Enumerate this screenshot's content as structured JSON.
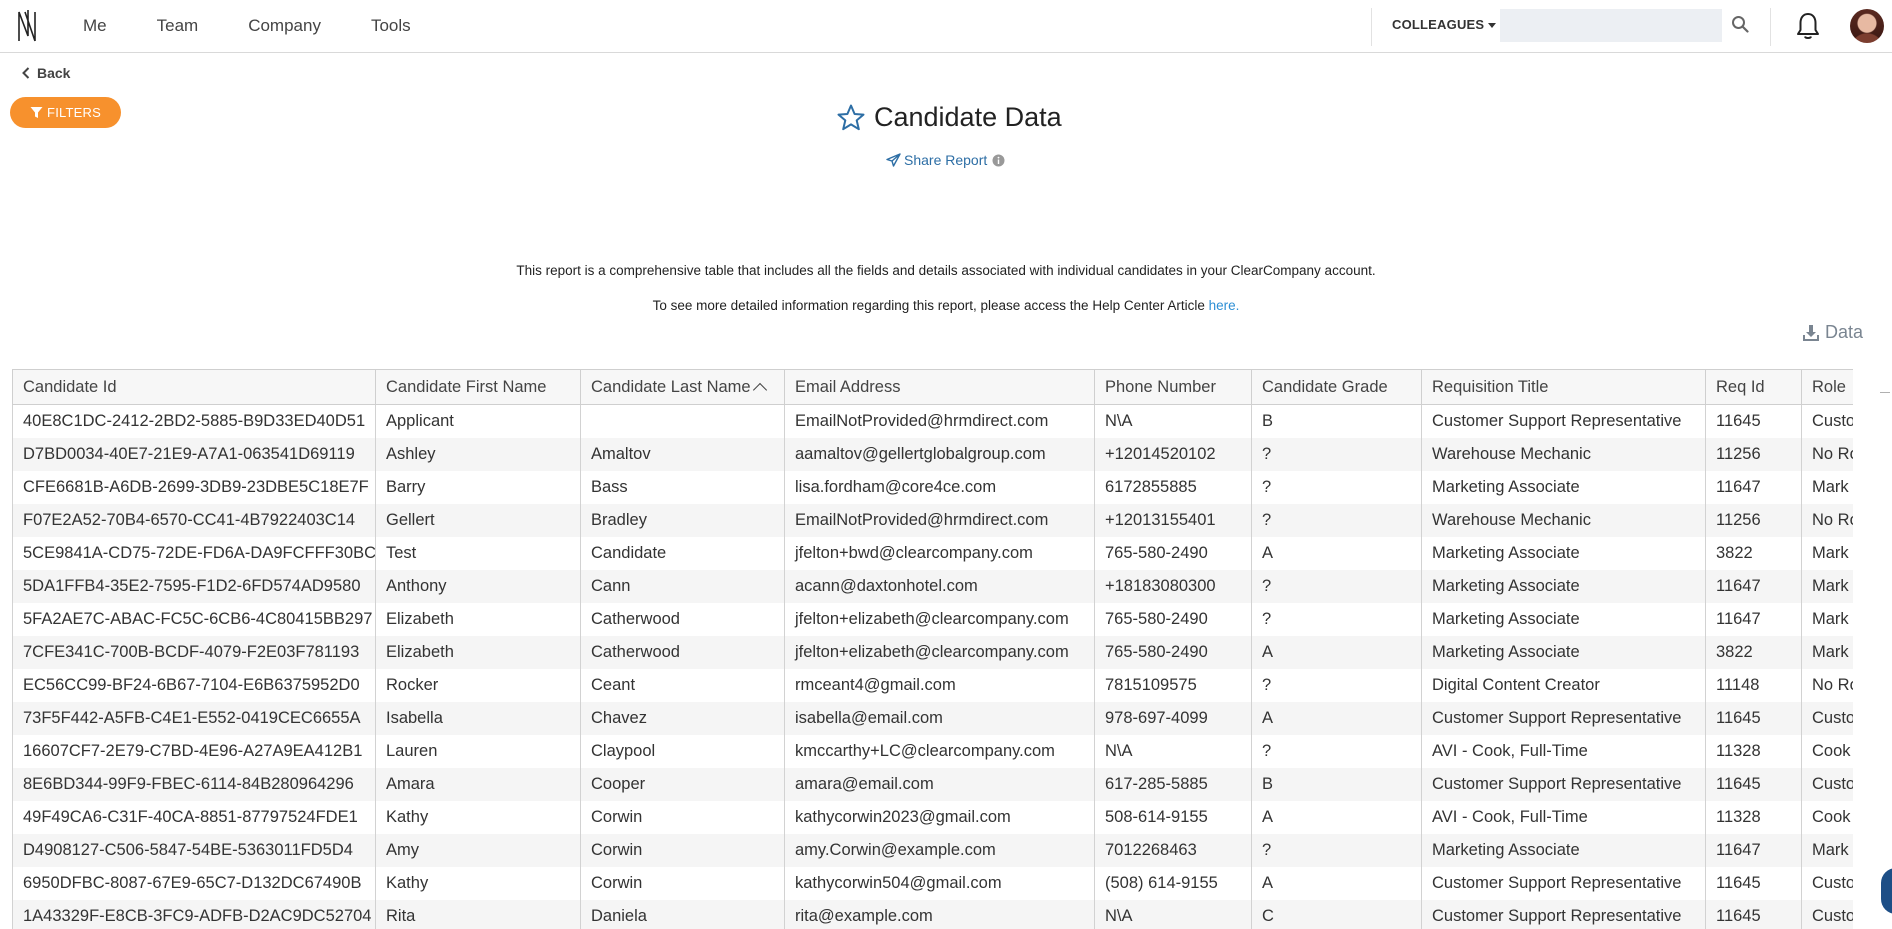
{
  "nav": {
    "links": [
      "Me",
      "Team",
      "Company",
      "Tools"
    ],
    "colleagues_label": "COLLEAGUES",
    "search_placeholder": ""
  },
  "back_label": "Back",
  "filters_label": "FILTERS",
  "report": {
    "title": "Candidate Data",
    "share_label": "Share Report",
    "description": "This report is a comprehensive table that includes all the fields and details associated with individual candidates in your ClearCompany account.",
    "help_text": "To see more detailed information regarding this report, please access the Help Center Article ",
    "help_link": "here."
  },
  "data_button_label": "Data",
  "table": {
    "columns": [
      "Candidate Id",
      "Candidate First Name",
      "Candidate Last Name",
      "Email Address",
      "Phone Number",
      "Candidate Grade",
      "Requisition Title",
      "Req Id",
      "Role"
    ],
    "sorted_column": "Candidate Last Name",
    "sort_direction": "ascending",
    "rows": [
      [
        "40E8C1DC-2412-2BD2-5885-B9D33ED40D51",
        "Applicant",
        "",
        "EmailNotProvided@hrmdirect.com",
        "N\\A",
        "B",
        "Customer Support Representative",
        "11645",
        "Custo"
      ],
      [
        "D7BD0034-40E7-21E9-A7A1-063541D69119",
        "Ashley",
        "Amaltov",
        "aamaltov@gellertglobalgroup.com",
        "+12014520102",
        "?",
        "Warehouse Mechanic",
        "11256",
        "No Ro"
      ],
      [
        "CFE6681B-A6DB-2699-3DB9-23DBE5C18E7F",
        "Barry",
        "Bass",
        "lisa.fordham@core4ce.com",
        "6172855885",
        "?",
        "Marketing Associate",
        "11647",
        "Mark"
      ],
      [
        "F07E2A52-70B4-6570-CC41-4B7922403C14",
        "Gellert",
        "Bradley",
        "EmailNotProvided@hrmdirect.com",
        "+12013155401",
        "?",
        "Warehouse Mechanic",
        "11256",
        "No Ro"
      ],
      [
        "5CE9841A-CD75-72DE-FD6A-DA9FCFFF30BC",
        "Test",
        "Candidate",
        "jfelton+bwd@clearcompany.com",
        "765-580-2490",
        "A",
        "Marketing Associate",
        "3822",
        "Mark"
      ],
      [
        "5DA1FFB4-35E2-7595-F1D2-6FD574AD9580",
        "Anthony",
        "Cann",
        "acann@daxtonhotel.com",
        "+18183080300",
        "?",
        "Marketing Associate",
        "11647",
        "Mark"
      ],
      [
        "5FA2AE7C-ABAC-FC5C-6CB6-4C80415BB297",
        "Elizabeth",
        "Catherwood",
        "jfelton+elizabeth@clearcompany.com",
        "765-580-2490",
        "?",
        "Marketing Associate",
        "11647",
        "Mark"
      ],
      [
        "7CFE341C-700B-BCDF-4079-F2E03F781193",
        "Elizabeth",
        "Catherwood",
        "jfelton+elizabeth@clearcompany.com",
        "765-580-2490",
        "A",
        "Marketing Associate",
        "3822",
        "Mark"
      ],
      [
        "EC56CC99-BF24-6B67-7104-E6B6375952D0",
        "Rocker",
        "Ceant",
        "rmceant4@gmail.com",
        "7815109575",
        "?",
        "Digital Content Creator",
        "11148",
        "No Ro"
      ],
      [
        "73F5F442-A5FB-C4E1-E552-0419CEC6655A",
        "Isabella",
        "Chavez",
        "isabella@email.com",
        "978-697-4099",
        "A",
        "Customer Support Representative",
        "11645",
        "Custo"
      ],
      [
        "16607CF7-2E79-C7BD-4E96-A27A9EA412B1",
        "Lauren",
        "Claypool",
        "kmccarthy+LC@clearcompany.com",
        "N\\A",
        "?",
        "AVI - Cook, Full-Time",
        "11328",
        "Cook"
      ],
      [
        "8E6BD344-99F9-FBEC-6114-84B280964296",
        "Amara",
        "Cooper",
        "amara@email.com",
        "617-285-5885",
        "B",
        "Customer Support Representative",
        "11645",
        "Custo"
      ],
      [
        "49F49CA6-C31F-40CA-8851-87797524FDE1",
        "Kathy",
        "Corwin",
        "kathycorwin2023@gmail.com",
        "508-614-9155",
        "A",
        "AVI - Cook, Full-Time",
        "11328",
        "Cook"
      ],
      [
        "D4908127-C506-5847-54BE-5363011FD5D4",
        "Amy",
        "Corwin",
        "amy.Corwin@example.com",
        "7012268463",
        "?",
        "Marketing Associate",
        "11647",
        "Mark"
      ],
      [
        "6950DFBC-8087-67E9-65C7-D132DC67490B",
        "Kathy",
        "Corwin",
        "kathycorwin504@gmail.com",
        "(508) 614-9155",
        "A",
        "Customer Support Representative",
        "11645",
        "Custo"
      ],
      [
        "1A43329F-E8CB-3FC9-ADFB-D2AC9DC52704",
        "Rita",
        "Daniela",
        "rita@example.com",
        "N\\A",
        "C",
        "Customer Support Representative",
        "11645",
        "Custo"
      ]
    ]
  },
  "colors": {
    "accent_orange": "#f7912d",
    "link_blue": "#2d8fd5",
    "share_blue": "#2d6ea5"
  },
  "icons": {
    "logo": "logo-icon",
    "search": "search-icon",
    "bell": "bell-icon",
    "back": "chevron-left-icon",
    "filter": "filter-icon",
    "star": "star-icon",
    "share": "paper-plane-icon",
    "info": "info-icon",
    "download": "download-icon"
  }
}
